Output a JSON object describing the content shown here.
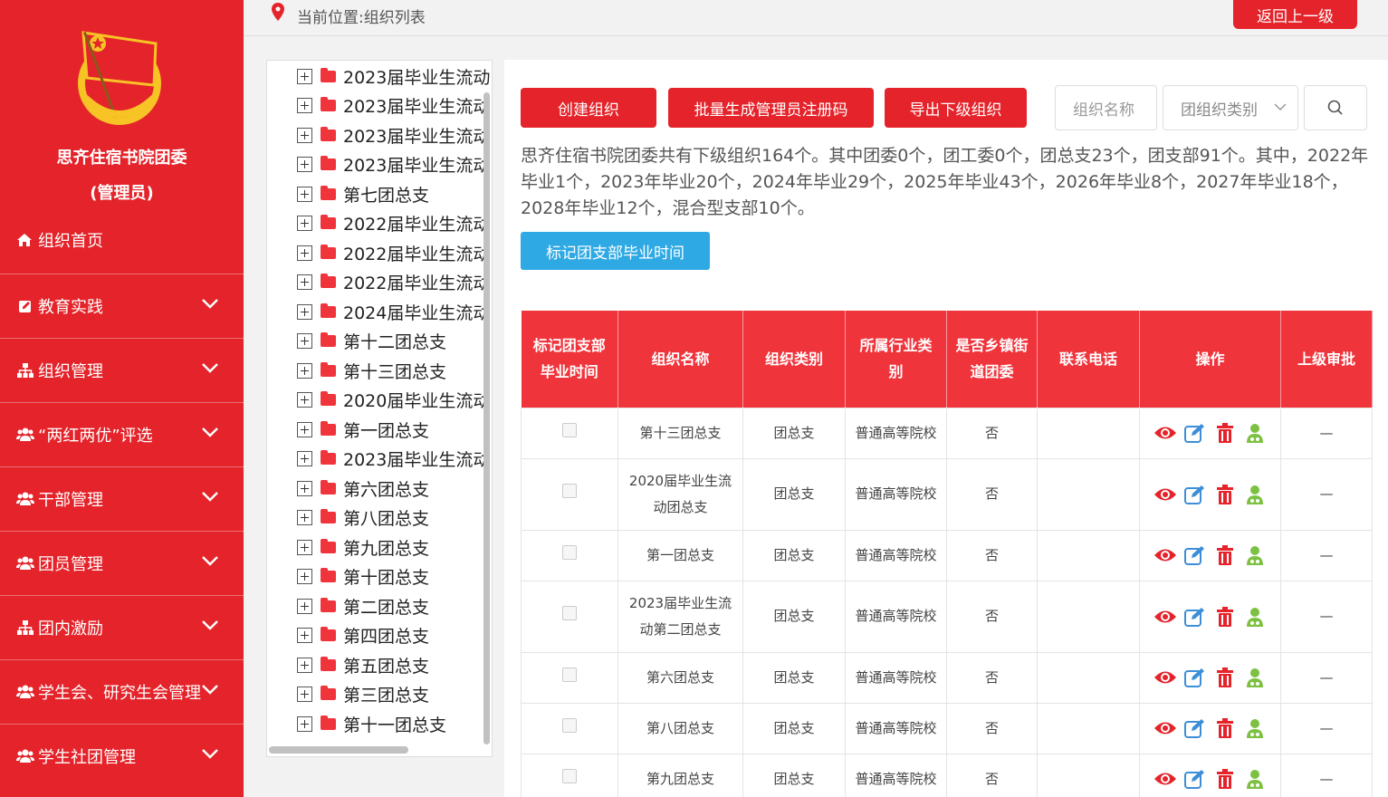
{
  "sidebar": {
    "org_name": "思齐住宿书院团委",
    "role": "(管理员)",
    "home": {
      "label": "组织首页",
      "icon": "home-icon"
    },
    "items": [
      {
        "label": "教育实践",
        "icon": "edit-icon"
      },
      {
        "label": "组织管理",
        "icon": "sitemap-icon"
      },
      {
        "label": "“两红两优”评选",
        "icon": "users-icon"
      },
      {
        "label": "干部管理",
        "icon": "users-icon"
      },
      {
        "label": "团员管理",
        "icon": "users-icon"
      },
      {
        "label": "团内激励",
        "icon": "sitemap-icon"
      },
      {
        "label": "学生会、研究生会管理",
        "icon": "users-icon"
      },
      {
        "label": "学生社团管理",
        "icon": "users-icon"
      }
    ]
  },
  "header": {
    "breadcrumb": "当前位置:组织列表",
    "back_label": "返回上一级"
  },
  "tree": {
    "items": [
      "2023届毕业生流动",
      "2023届毕业生流动",
      "2023届毕业生流动",
      "2023届毕业生流动",
      "第七团总支",
      "2022届毕业生流动",
      "2022届毕业生流动",
      "2022届毕业生流动",
      "2024届毕业生流动",
      "第十二团总支",
      "第十三团总支",
      "2020届毕业生流动",
      "第一团总支",
      "2023届毕业生流动",
      "第六团总支",
      "第八团总支",
      "第九团总支",
      "第十团总支",
      "第二团总支",
      "第四团总支",
      "第五团总支",
      "第三团总支",
      "第十一团总支"
    ]
  },
  "toolbar": {
    "create_label": "创建组织",
    "batch_label": "批量生成管理员注册码",
    "export_label": "导出下级组织",
    "search_placeholder": "组织名称",
    "category_select": "团组织类别",
    "mark_label": "标记团支部毕业时间"
  },
  "summary": "思齐住宿书院团委共有下级组织164个。其中团委0个，团工委0个，团总支23个，团支部91个。其中，2022年毕业1个，2023年毕业20个，2024年毕业29个，2025年毕业43个，2026年毕业8个，2027年毕业18个，2028年毕业12个，混合型支部10个。",
  "table": {
    "headers": [
      "标记团支部毕业时间",
      "组织名称",
      "组织类别",
      "所属行业类别",
      "是否乡镇街道团委",
      "联系电话",
      "操作",
      "上级审批"
    ],
    "rows": [
      {
        "name": "第十三团总支",
        "category": "团总支",
        "industry": "普通高等院校",
        "township": "否",
        "phone": "",
        "approval": "—"
      },
      {
        "name": "2020届毕业生流动团总支",
        "category": "团总支",
        "industry": "普通高等院校",
        "township": "否",
        "phone": "",
        "approval": "—"
      },
      {
        "name": "第一团总支",
        "category": "团总支",
        "industry": "普通高等院校",
        "township": "否",
        "phone": "",
        "approval": "—"
      },
      {
        "name": "2023届毕业生流动第二团总支",
        "category": "团总支",
        "industry": "普通高等院校",
        "township": "否",
        "phone": "",
        "approval": "—"
      },
      {
        "name": "第六团总支",
        "category": "团总支",
        "industry": "普通高等院校",
        "township": "否",
        "phone": "",
        "approval": "—"
      },
      {
        "name": "第八团总支",
        "category": "团总支",
        "industry": "普通高等院校",
        "township": "否",
        "phone": "",
        "approval": "—"
      },
      {
        "name": "第九团总支",
        "category": "团总支",
        "industry": "普通高等院校",
        "township": "否",
        "phone": "",
        "approval": "—"
      }
    ]
  },
  "colors": {
    "brand_red": "#e4232a",
    "header_red": "#f0343c",
    "info_blue": "#2fa9e4",
    "edit_blue": "#3c8ed8",
    "admin_green": "#7cc142"
  }
}
